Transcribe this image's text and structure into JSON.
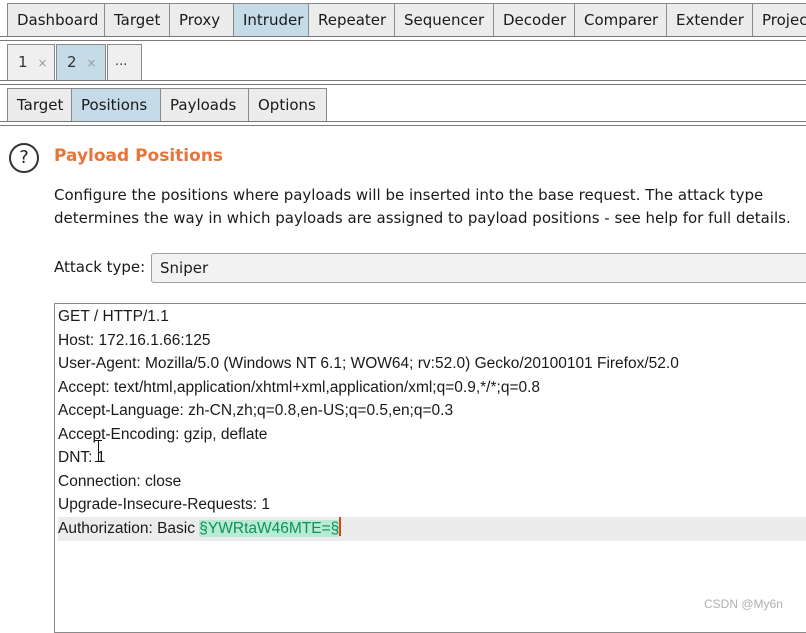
{
  "top_tabs": [
    "Dashboard",
    "Target",
    "Proxy",
    "Intruder",
    "Repeater",
    "Sequencer",
    "Decoder",
    "Comparer",
    "Extender",
    "Project"
  ],
  "active_top_tab": "Intruder",
  "attack_tabs": [
    {
      "label": "1",
      "close": "×"
    },
    {
      "label": "2",
      "close": "×"
    },
    {
      "label": "..."
    }
  ],
  "active_attack_tab": "2",
  "intruder_tabs": [
    "Target",
    "Positions",
    "Payloads",
    "Options"
  ],
  "active_intruder_tab": "Positions",
  "section": {
    "help_icon": "question-mark-icon",
    "title": "Payload Positions",
    "description": "Configure the positions where payloads will be inserted into the base request. The attack type determines the way in which payloads are assigned to payload positions - see help for full details."
  },
  "attack_type": {
    "label": "Attack type:",
    "value": "Sniper"
  },
  "request_lines": [
    "GET / HTTP/1.1",
    "Host: 172.16.1.66:125",
    "User-Agent: Mozilla/5.0 (Windows NT 6.1; WOW64; rv:52.0) Gecko/20100101 Firefox/52.0",
    "Accept: text/html,application/xhtml+xml,application/xml;q=0.9,*/*;q=0.8",
    "Accept-Language: zh-CN,zh;q=0.8,en-US;q=0.5,en;q=0.3",
    "Accept-Encoding: gzip, deflate",
    "DNT: 1",
    "Connection: close",
    "Upgrade-Insecure-Requests: 1"
  ],
  "auth_line": {
    "prefix": "Authorization: Basic ",
    "payload": "§YWRtaW46MTE=§"
  },
  "watermark": "CSDN @My6n",
  "colors": {
    "active_tab": "#c5dbe8",
    "title_accent": "#e8743b",
    "payload_marker_bg": "#b7ecd3",
    "payload_marker_text": "#0f8f5c"
  }
}
